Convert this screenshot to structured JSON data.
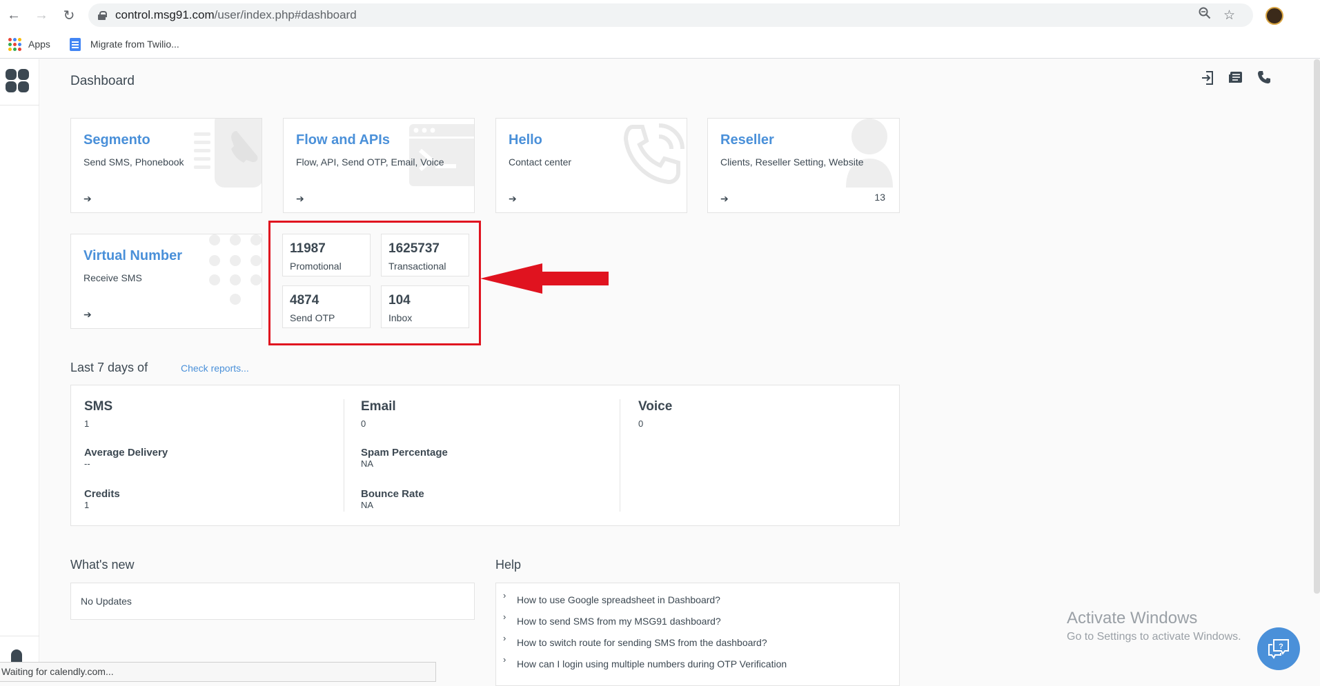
{
  "browser": {
    "url_host": "control.msg91.com",
    "url_path": "/user/index.php#dashboard",
    "bookmarks": [
      {
        "label": "Apps"
      },
      {
        "label": "Migrate from Twilio..."
      }
    ]
  },
  "page": {
    "title": "Dashboard"
  },
  "cards": [
    {
      "title": "Segmento",
      "subtitle": "Send SMS, Phonebook",
      "icon": "phone-keypad-icon"
    },
    {
      "title": "Flow and APIs",
      "subtitle": "Flow, API, Send OTP, Email, Voice",
      "icon": "terminal-window-icon"
    },
    {
      "title": "Hello",
      "subtitle": "Contact center",
      "icon": "phone-ringing-icon"
    },
    {
      "title": "Reseller",
      "subtitle": "Clients, Reseller Setting, Website",
      "icon": "user-icon",
      "count": "13"
    },
    {
      "title": "Virtual Number",
      "subtitle": "Receive SMS",
      "icon": "dialpad-icon"
    }
  ],
  "stats": [
    {
      "value": "11987",
      "label": "Promotional"
    },
    {
      "value": "1625737",
      "label": "Transactional"
    },
    {
      "value": "4874",
      "label": "Send OTP"
    },
    {
      "value": "104",
      "label": "Inbox"
    }
  ],
  "reports": {
    "heading": "Last 7 days of",
    "link": "Check reports...",
    "sms": {
      "title": "SMS",
      "value": "1",
      "avg_label": "Average Delivery",
      "avg_value": "--",
      "credits_label": "Credits",
      "credits_value": "1"
    },
    "email": {
      "title": "Email",
      "value": "0",
      "spam_label": "Spam Percentage",
      "spam_value": "NA",
      "bounce_label": "Bounce Rate",
      "bounce_value": "NA"
    },
    "voice": {
      "title": "Voice",
      "value": "0"
    }
  },
  "whats_new": {
    "heading": "What's new",
    "body": "No Updates"
  },
  "help": {
    "heading": "Help",
    "items": [
      "How to use Google spreadsheet in Dashboard?",
      "How to send SMS from my MSG91 dashboard?",
      "How to switch route for sending SMS from the dashboard?",
      "How can I login using multiple numbers during OTP Verification"
    ]
  },
  "watermark": {
    "line1": "Activate Windows",
    "line2": "Go to Settings to activate Windows."
  },
  "status_bar": "Waiting for calendly.com...",
  "colors": {
    "accent": "#4a90d9",
    "highlight": "#e0131f",
    "text": "#3c4852"
  }
}
